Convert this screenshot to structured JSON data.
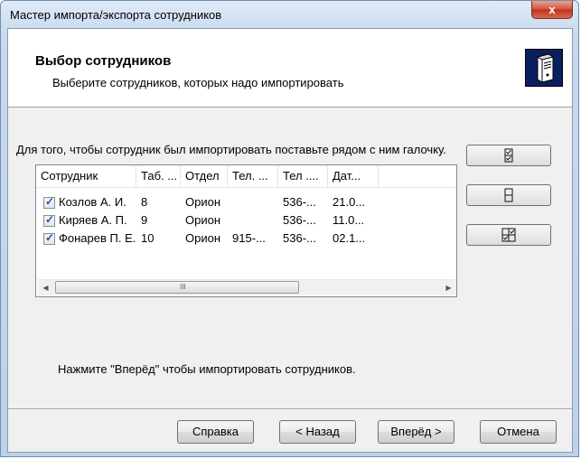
{
  "window": {
    "title": "Мастер импорта/экспорта сотрудников",
    "close_glyph": "x"
  },
  "header": {
    "title": "Выбор сотрудников",
    "subtitle": "Выберите сотрудников, которых  надо импортировать",
    "icon": "server-icon"
  },
  "instruction": "Для того, чтобы сотрудник был импортировать поставьте рядом с ним галочку.",
  "employees": {
    "columns": [
      "Сотрудник",
      "Таб. ...",
      "Отдел",
      "Тел. ...",
      "Тел ....",
      "Дат..."
    ],
    "rows": [
      {
        "checked": true,
        "name": "Козлов А. И.",
        "tab": "8",
        "dept": "Орион",
        "phone1": "",
        "phone2": "536-...",
        "date": "21.0..."
      },
      {
        "checked": true,
        "name": "Киряев А. П.",
        "tab": "9",
        "dept": "Орион",
        "phone1": "",
        "phone2": "536-...",
        "date": "11.0..."
      },
      {
        "checked": true,
        "name": "Фонарев П. Е.",
        "tab": "10",
        "dept": "Орион",
        "phone1": "915-...",
        "phone2": "536-...",
        "date": "02.1..."
      }
    ],
    "scroll_grip": "III"
  },
  "side_buttons": [
    {
      "name": "check-all-icon"
    },
    {
      "name": "uncheck-all-icon"
    },
    {
      "name": "invert-selection-icon"
    }
  ],
  "status_text": "Нажмите \"Вперёд\" чтобы импортировать сотрудников.",
  "buttons": {
    "help": "Справка",
    "back": "< Назад",
    "next": "Вперёд >",
    "cancel": "Отмена"
  }
}
